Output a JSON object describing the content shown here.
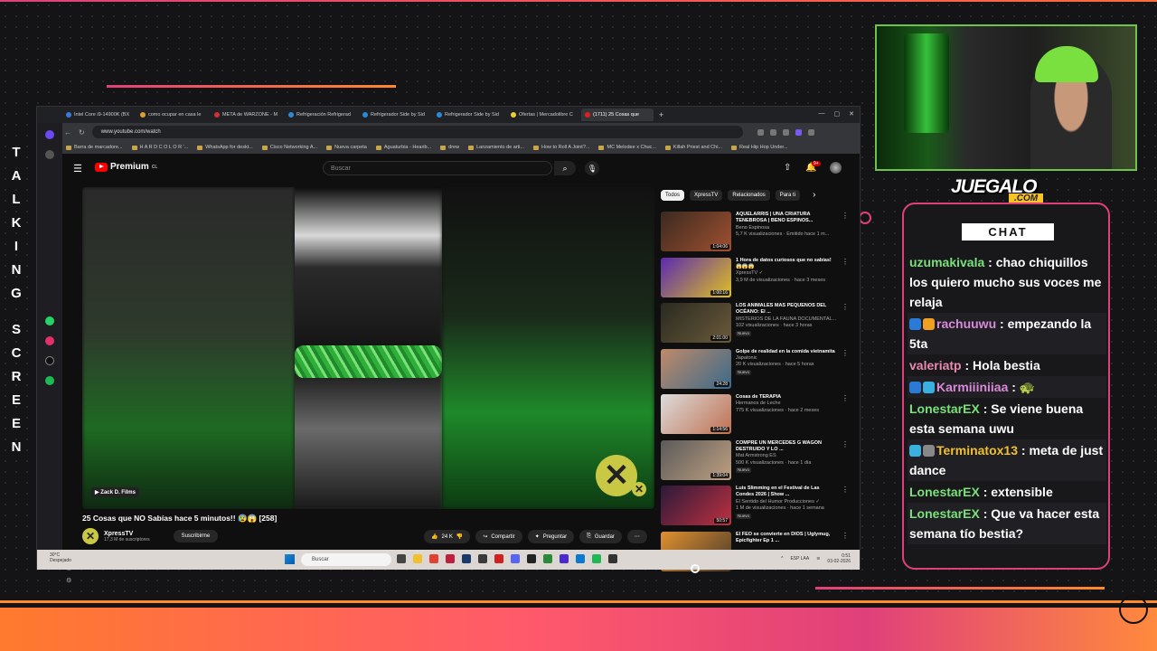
{
  "overlay": {
    "side_text": [
      "T",
      "A",
      "L",
      "K",
      "I",
      "N",
      "G",
      "S",
      "C",
      "R",
      "E",
      "E",
      "N"
    ],
    "brand": "JUEGALO",
    "brand_sub": ".COM",
    "colors": {
      "accent": "#e0407a",
      "orange": "#ff8a2a",
      "green": "#6fc24a"
    }
  },
  "browser": {
    "tabs": [
      "Intel Core i9-14900K (BX",
      "como ocupar en casa le",
      "META de WARZONE - M",
      "Refrigeración Refrigerad",
      "Refrigerador Side by Sid",
      "Refrigerador Side by Sid",
      "Ofertas | Mercadolibre C",
      "(1711) 25 Cosas que"
    ],
    "url": "www.youtube.com/watch",
    "bookmarks": [
      "Barra de marcadore...",
      "H A R D C O L O R '...",
      "WhatsApp for deskt...",
      "Cisco Networking A...",
      "Nueva carpeta",
      "Aguaturbia - Hearib...",
      "drew",
      "Lanzamiento de arti...",
      "How to Roll A Joint?...",
      "MC Melodee x Chuc...",
      "Killah Priest and Chi...",
      "Real Hip Hop Under..."
    ]
  },
  "youtube": {
    "logo_text": "Premium",
    "logo_sup": "CL",
    "search_placeholder": "Buscar",
    "notif_count": "9+",
    "video": {
      "badge": "Zack D. Films",
      "title": "25 Cosas que NO Sabías hace 5 minutos!! 😰😱 [258]",
      "channel": "XpressTV",
      "subs": "17,3 M de suscriptores",
      "subscribe": "Suscribirme",
      "likes": "24 K",
      "share": "Compartir",
      "ask": "Preguntar",
      "save": "Guardar"
    },
    "chips": [
      "Todos",
      "XpressTV",
      "Relacionados",
      "Para ti"
    ],
    "recs": [
      {
        "title": "AQUELARRIS | UNA CRIATURA TENEBROSA | BENO ESPINOS...",
        "channel": "Beno Espinosa",
        "meta": "5,7 K visualizaciones · Emitido hace 1 m...",
        "duration": "1:04:06",
        "new": "",
        "c1": "#3a2a20",
        "c2": "#a05030"
      },
      {
        "title": "1 Hora de datos curiosos que no sabías! 😱😱😱",
        "channel": "XpressTV ✓",
        "meta": "3,9 M de visualizaciones · hace 3 meses",
        "duration": "1:00:16",
        "new": "",
        "c1": "#5a2ab0",
        "c2": "#e0c020"
      },
      {
        "title": "LOS ANIMALES MÁS PEQUEÑOS DEL OCÉANO: El ...",
        "channel": "MISTERIOS DE LA FAUNA DOCUMENTAL...",
        "meta": "102 visualizaciones · hace 3 horas",
        "duration": "2:01:00",
        "new": "Nuevo",
        "c1": "#2a2a20",
        "c2": "#6a5a3a"
      },
      {
        "title": "Golpe de realidad en la comida vietnamita",
        "channel": "Japatonic",
        "meta": "20 K visualizaciones · hace 5 horas",
        "duration": "24:28",
        "new": "Nuevo",
        "c1": "#c08a6a",
        "c2": "#3a6a8a"
      },
      {
        "title": "Cosas de TERAPIA",
        "channel": "Hermanos de Leche",
        "meta": "775 K visualizaciones · hace 2 meses",
        "duration": "1:14:56",
        "new": "",
        "c1": "#dcdcdc",
        "c2": "#c07050"
      },
      {
        "title": "COMPRÉ UN MERCEDES G WAGON DESTRUIDO Y LO ...",
        "channel": "Mat Armstrong ES",
        "meta": "500 K visualizaciones · hace 1 día",
        "duration": "1:39:04",
        "new": "Nuevo",
        "c1": "#5a5a5a",
        "c2": "#c0a080"
      },
      {
        "title": "Luis Slimming en el Festival de Las Condes 2026 | Show ...",
        "channel": "El Sentido del Humor Producciones ✓",
        "meta": "1 M de visualizaciones · hace 1 semana",
        "duration": "50:57",
        "new": "Nuevo",
        "c1": "#2a1a3a",
        "c2": "#c03040"
      },
      {
        "title": "El FEO se convierte en DIOS | Uglymug, Epicfighter Ep 1 ...",
        "channel": "",
        "meta": "",
        "duration": "",
        "new": "",
        "c1": "#e09030",
        "c2": "#4a3a2a"
      }
    ]
  },
  "taskbar": {
    "temp": "30°C",
    "weather": "Despejado",
    "search": "Buscar",
    "lang": "ESP LAA",
    "time": "0:51",
    "date": "03-02-2026"
  },
  "chat": {
    "title": "CHAT",
    "messages": [
      {
        "user": "uzumakivala",
        "color": "#7ae07a",
        "badges": [],
        "text": ": chao chiquillos los quiero mucho sus voces me relaja"
      },
      {
        "user": "rachuuwu",
        "color": "#d88ad8",
        "badges": [
          "#2a7ad8",
          "#f0a020"
        ],
        "text": ": empezando la 5ta"
      },
      {
        "user": "valeriatp",
        "color": "#e88ab0",
        "badges": [],
        "text": ": Hola bestia"
      },
      {
        "user": "Karmiiiniiaa",
        "color": "#d88ad8",
        "badges": [
          "#2a7ad8",
          "#3ab0e0"
        ],
        "text": ": 🐢"
      },
      {
        "user": "LonestarEX",
        "color": "#7ae07a",
        "badges": [],
        "text": ": Se viene buena esta semana uwu"
      },
      {
        "user": "Terminatox13",
        "color": "#f0c030",
        "badges": [
          "#3ab0e0",
          "#888888"
        ],
        "text": ": meta de just dance"
      },
      {
        "user": "LonestarEX",
        "color": "#7ae07a",
        "badges": [],
        "text": ": extensible"
      },
      {
        "user": "LonestarEX",
        "color": "#7ae07a",
        "badges": [],
        "text": ": Que va hacer esta semana tío bestia?"
      }
    ]
  }
}
